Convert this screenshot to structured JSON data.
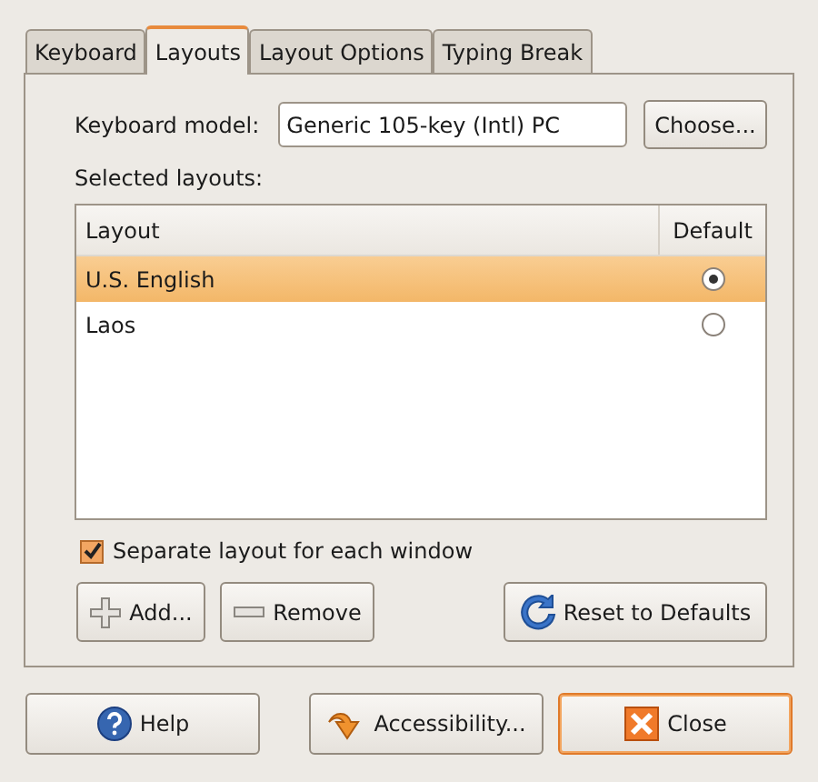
{
  "tabs": [
    {
      "label": "Keyboard",
      "selected": false
    },
    {
      "label": "Layouts",
      "selected": true
    },
    {
      "label": "Layout Options",
      "selected": false
    },
    {
      "label": "Typing Break",
      "selected": false
    }
  ],
  "keyboard_model": {
    "label": "Keyboard model:",
    "value": "Generic 105-key (Intl) PC",
    "button": "Choose..."
  },
  "selected_layouts_label": "Selected layouts:",
  "table": {
    "columns": [
      "Layout",
      "Default"
    ],
    "rows": [
      {
        "layout": "U.S. English",
        "selected": true,
        "default": true
      },
      {
        "layout": "Laos",
        "selected": false,
        "default": false
      }
    ]
  },
  "separate_layout": {
    "label": "Separate layout for each window",
    "checked": true
  },
  "layout_buttons": [
    {
      "label": "Add...",
      "kind": "add"
    },
    {
      "label": "Remove",
      "kind": "remove"
    },
    {
      "label": "Reset to Defaults",
      "kind": "reset"
    }
  ],
  "dialog_buttons": [
    {
      "label": "Help",
      "kind": "help",
      "focused": false
    },
    {
      "label": "Accessibility...",
      "kind": "accessibility",
      "focused": false
    },
    {
      "label": "Close",
      "kind": "close",
      "focused": true
    }
  ]
}
